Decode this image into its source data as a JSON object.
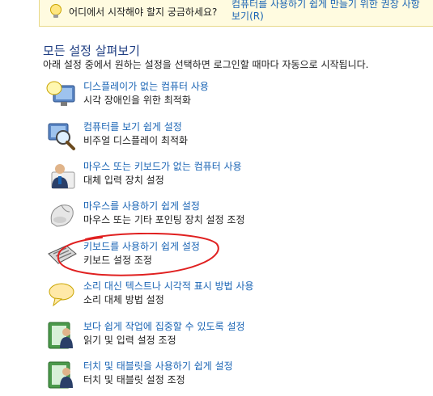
{
  "tip": {
    "icon": "lightbulb-icon",
    "question": "어디에서 시작해야 할지 궁금하세요?",
    "link_line1": "컴퓨터를 사용하기 쉽게 만들기 위한 권장 사항",
    "link_line2": "보기(R)"
  },
  "section": {
    "title": "모든 설정 살펴보기",
    "description": "아래 설정 중에서 원하는 설정을 선택하면 로그인할 때마다 자동으로 시작됩니다."
  },
  "items": [
    {
      "icon": "monitor-magnifier-icon",
      "link": "디스플레이가 없는 컴퓨터 사용",
      "sub": "시각 장애인을 위한 최적화"
    },
    {
      "icon": "magnifier-icon",
      "link": "컴퓨터를 보기 쉽게 설정",
      "sub": "비주얼 디스플레이 최적화"
    },
    {
      "icon": "user-icon",
      "link": "마우스 또는 키보드가 없는 컴퓨터 사용",
      "sub": "대체 입력 장치 설정"
    },
    {
      "icon": "mouse-icon",
      "link": "마우스를 사용하기 쉽게 설정",
      "sub": "마우스 또는 기타 포인팅 장치 설정 조정"
    },
    {
      "icon": "keyboard-icon",
      "link": "키보드를 사용하기 쉽게 설정",
      "sub": "키보드 설정 조정"
    },
    {
      "icon": "speech-bubble-icon",
      "link": "소리 대신 텍스트나 시각적 표시 방법 사용",
      "sub": "소리 대체 방법 설정"
    },
    {
      "icon": "reading-user-icon",
      "link": "보다 쉽게 작업에 집중할 수 있도록 설정",
      "sub": "읽기 및 입력 설정 조정"
    },
    {
      "icon": "tablet-user-icon",
      "link": "터치 및 태블릿을 사용하기 쉽게 설정",
      "sub": "터치 및 태블릿 설정 조정"
    }
  ],
  "colors": {
    "link": "#1a64b4",
    "title": "#1e3d82",
    "annotation": "#e02020"
  }
}
